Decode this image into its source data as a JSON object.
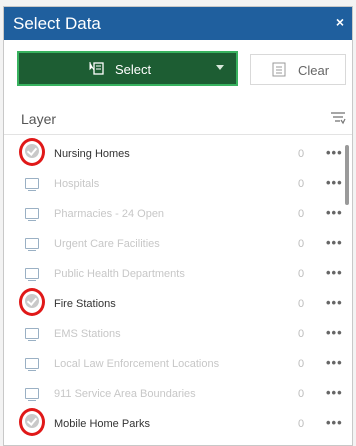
{
  "dialog": {
    "title": "Select Data",
    "close_glyph": "×"
  },
  "toolbar": {
    "select_label": "Select",
    "clear_label": "Clear"
  },
  "list": {
    "header": "Layer",
    "items": [
      {
        "label": "Nursing Homes",
        "count": "0",
        "checked": true
      },
      {
        "label": "Hospitals",
        "count": "0",
        "checked": false
      },
      {
        "label": "Pharmacies - 24 Open",
        "count": "0",
        "checked": false
      },
      {
        "label": "Urgent Care Facilities",
        "count": "0",
        "checked": false
      },
      {
        "label": "Public Health Departments",
        "count": "0",
        "checked": false
      },
      {
        "label": "Fire Stations",
        "count": "0",
        "checked": true
      },
      {
        "label": "EMS Stations",
        "count": "0",
        "checked": false
      },
      {
        "label": "Local Law Enforcement Locations",
        "count": "0",
        "checked": false
      },
      {
        "label": "911 Service Area Boundaries",
        "count": "0",
        "checked": false
      },
      {
        "label": "Mobile Home Parks",
        "count": "0",
        "checked": true
      }
    ],
    "more_glyph": "•••"
  },
  "colors": {
    "header_bg": "#1f5f9e",
    "select_bg": "#1d5d33",
    "select_border": "#38b25f",
    "highlight_ring": "#e01818"
  },
  "icons": {
    "select": "select-icon",
    "clear": "clear-icon",
    "filter": "filter-icon",
    "checkbox": "monitor-icon"
  }
}
